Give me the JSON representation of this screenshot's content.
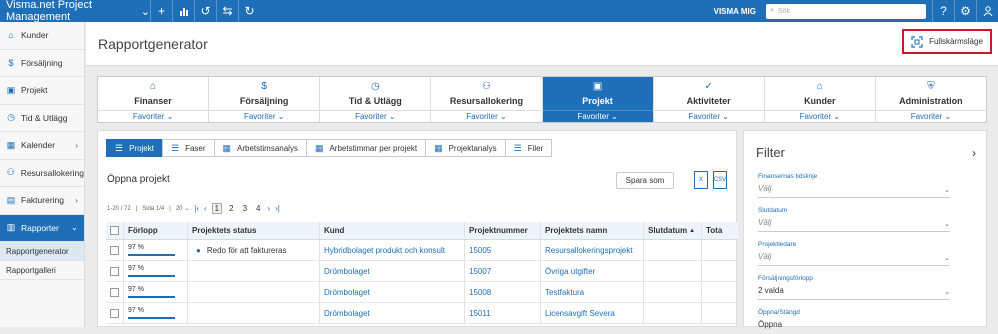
{
  "topbar": {
    "brand": "Visma.net Project Management",
    "user": "VISMA MIG",
    "search_placeholder": "Sök",
    "icons": [
      "chevron-down-icon",
      "plus-icon",
      "chart-icon",
      "history-icon",
      "swap-icon",
      "refresh-icon",
      "help-icon",
      "gear-icon",
      "user-icon"
    ],
    "color": "#1f6fb8"
  },
  "sidebar": {
    "items": [
      {
        "label": "Kunder",
        "icon": "customers-icon"
      },
      {
        "label": "Försäljning",
        "icon": "dollar-icon"
      },
      {
        "label": "Projekt",
        "icon": "project-icon"
      },
      {
        "label": "Tid & Utlägg",
        "icon": "clock-icon"
      },
      {
        "label": "Kalender",
        "icon": "calendar-icon",
        "has_children": true
      },
      {
        "label": "Resursallokering",
        "icon": "resource-icon"
      },
      {
        "label": "Fakturering",
        "icon": "invoice-icon",
        "has_children": true
      },
      {
        "label": "Rapporter",
        "icon": "reports-icon",
        "has_children": true,
        "active": true
      }
    ],
    "subitems": [
      {
        "label": "Rapportgenerator",
        "selected": true
      },
      {
        "label": "Rapportgalleri"
      }
    ]
  },
  "header": {
    "title": "Rapportgenerator",
    "fullscreen_label": "Fullskärmsläge"
  },
  "modules": [
    {
      "label": "Finanser",
      "fav": "Favoriter",
      "icon": "bank-icon"
    },
    {
      "label": "Försäljning",
      "fav": "Favoriter",
      "icon": "dollar-icon"
    },
    {
      "label": "Tid & Utlägg",
      "fav": "Favoriter",
      "icon": "clock-icon"
    },
    {
      "label": "Resursallokering",
      "fav": "Favoriter",
      "icon": "resource-icon"
    },
    {
      "label": "Projekt",
      "fav": "Favoriter",
      "icon": "project-icon",
      "active": true
    },
    {
      "label": "Aktiviteter",
      "fav": "Favoriter",
      "icon": "check-icon"
    },
    {
      "label": "Kunder",
      "fav": "Favoriter",
      "icon": "customers-icon"
    },
    {
      "label": "Administration",
      "fav": "Favoriter",
      "icon": "shield-icon"
    }
  ],
  "report_tabs": [
    {
      "label": "Projekt",
      "active": true
    },
    {
      "label": "Faser"
    },
    {
      "label": "Arbetstimsanalys"
    },
    {
      "label": "Arbetstimmar per projekt"
    },
    {
      "label": "Projektanalys"
    },
    {
      "label": "Filer"
    }
  ],
  "report": {
    "title": "Öppna projekt",
    "save_label": "Spara som",
    "export_excel": "X",
    "export_csv": "CSV",
    "pager": {
      "range": "1-20 / 72",
      "page_of": "Sida 1/4",
      "page_size": "20",
      "pages": [
        "1",
        "2",
        "3",
        "4"
      ],
      "current": "1"
    },
    "columns": [
      "Förlopp",
      "Projektets status",
      "Kund",
      "Projektnummer",
      "Projektets namn",
      "Slutdatum",
      "Tota"
    ],
    "rows": [
      {
        "progress": "97 %",
        "progress_value": 0.97,
        "status": "Redo för att faktureras",
        "kund": "Hybridbolaget produkt och konsult",
        "nummer": "15005",
        "namn": "Resursallokeringsprojekt"
      },
      {
        "progress": "97 %",
        "progress_value": 0.97,
        "status": "",
        "kund": "Drömbolaget",
        "nummer": "15007",
        "namn": "Övriga utgifter"
      },
      {
        "progress": "97 %",
        "progress_value": 0.97,
        "status": "",
        "kund": "Drömbolaget",
        "nummer": "15008",
        "namn": "Testfaktura"
      },
      {
        "progress": "97 %",
        "progress_value": 0.97,
        "status": "",
        "kund": "Drömbolaget",
        "nummer": "15011",
        "namn": "Licensavgift Severa"
      }
    ]
  },
  "filter": {
    "title": "Filter",
    "fields": [
      {
        "label": "Finansernas tidslinje",
        "value": "Välj",
        "placeholder": true
      },
      {
        "label": "Slutdatum",
        "value": "Välj",
        "placeholder": true
      },
      {
        "label": "Projektledare",
        "value": "Välj",
        "placeholder": true
      },
      {
        "label": "Försäljningsförlopp",
        "value": "2 valda",
        "placeholder": false
      },
      {
        "label": "Öppna/Stängd",
        "value": "Öppna",
        "placeholder": false
      }
    ]
  }
}
